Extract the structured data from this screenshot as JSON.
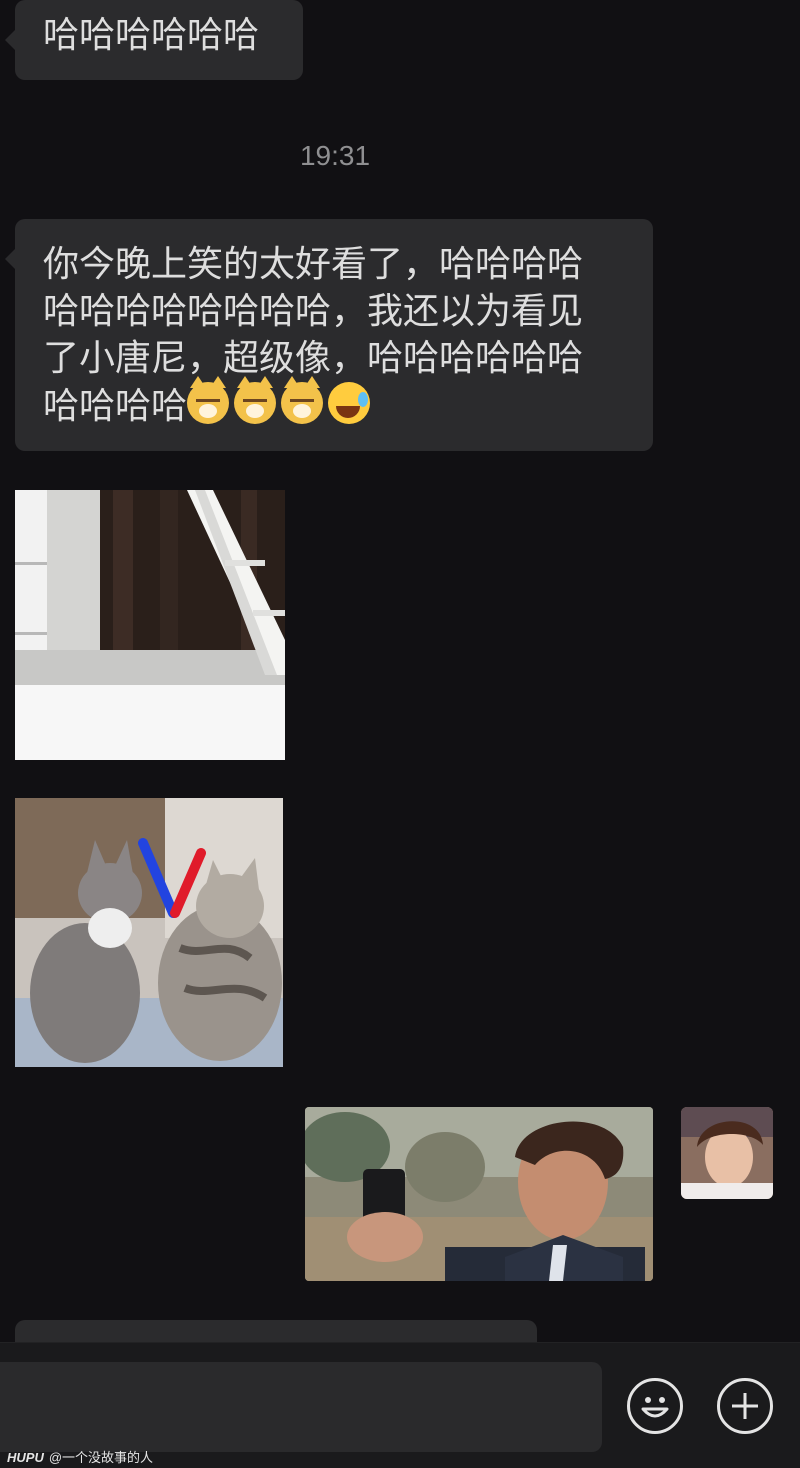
{
  "chat": {
    "messages": [
      {
        "lines": [
          "哈哈哈哈哈哈"
        ]
      },
      {
        "lines": [
          "你今晚上笑的太好看了，哈哈哈哈",
          "哈哈哈哈哈哈哈哈，我还以为看见",
          "了小唐尼，超级像，哈哈哈哈哈哈",
          "哈哈哈哈"
        ]
      }
    ],
    "timestamp": "19:31",
    "emojis": [
      "cat-face-emoji",
      "cat-face-emoji",
      "cat-face-emoji",
      "rolling-laughing-emoji"
    ]
  },
  "input_bar": {
    "emoji_icon": "smiley-icon",
    "plus_icon": "plus-icon"
  },
  "watermark": {
    "brand": "HUPU",
    "user": "@一个没故事的人"
  },
  "colors": {
    "background": "#111013",
    "bubble": "#2b2b2d",
    "text": "#dedede",
    "timestamp": "#8f8f91"
  }
}
